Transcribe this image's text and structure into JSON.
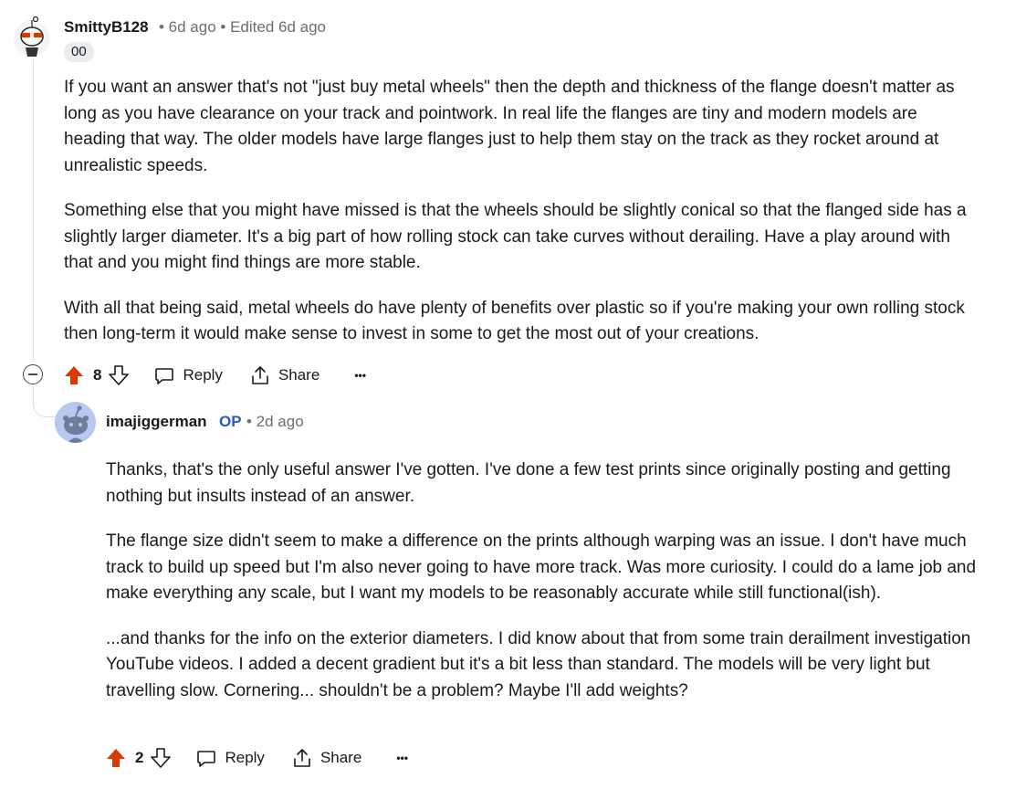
{
  "colors": {
    "upvote": "#d93a00",
    "op": "#2a59c8",
    "meta": "#6a6f73",
    "thread_line": "#dcdfe2"
  },
  "comment": {
    "username": "SmittyB128",
    "meta": "• 6d ago • Edited 6d ago",
    "flair": "00",
    "paragraphs": [
      "If you want an answer that's not \"just buy metal wheels\" then the depth and thickness of the flange doesn't matter as long as you have clearance on your track and pointwork. In real life the flanges are tiny and modern models are heading that way. The older models have large flanges just to help them stay on the track as they rocket around at unrealistic speeds.",
      "Something else that you might have missed is that the wheels should be slightly conical so that the flanged side has a slightly larger diameter. It's a big part of how rolling stock can take curves without derailing. Have a play around with that and you might find things are more stable.",
      "With all that being said, metal wheels do have plenty of benefits over plastic so if you're making your own rolling stock then long-term it would make sense to invest in some to get the most out of your creations."
    ],
    "votes": "8",
    "reply_label": "Reply",
    "share_label": "Share",
    "more_label": "•••"
  },
  "reply": {
    "username": "imajiggerman",
    "op_badge": "OP",
    "meta": "• 2d ago",
    "paragraphs": [
      "Thanks, that's the only useful answer I've gotten. I've done a few test prints since originally posting and getting nothing but insults instead of an answer.",
      "The flange size didn't seem to make a difference on the prints although warping was an issue. I don't have much track to build up speed but I'm also never going to have more track. Was more curiosity. I could do a lame job and make everything any scale, but I want my models to be reasonably accurate while still functional(ish).",
      "...and thanks for the info on the exterior diameters. I did know about that from some train derailment investigation YouTube videos. I added a decent gradient but it's a bit less than standard. The models will be very light but travelling slow. Cornering... shouldn't be a problem? Maybe I'll add weights?"
    ],
    "votes": "2",
    "reply_label": "Reply",
    "share_label": "Share",
    "more_label": "•••"
  }
}
